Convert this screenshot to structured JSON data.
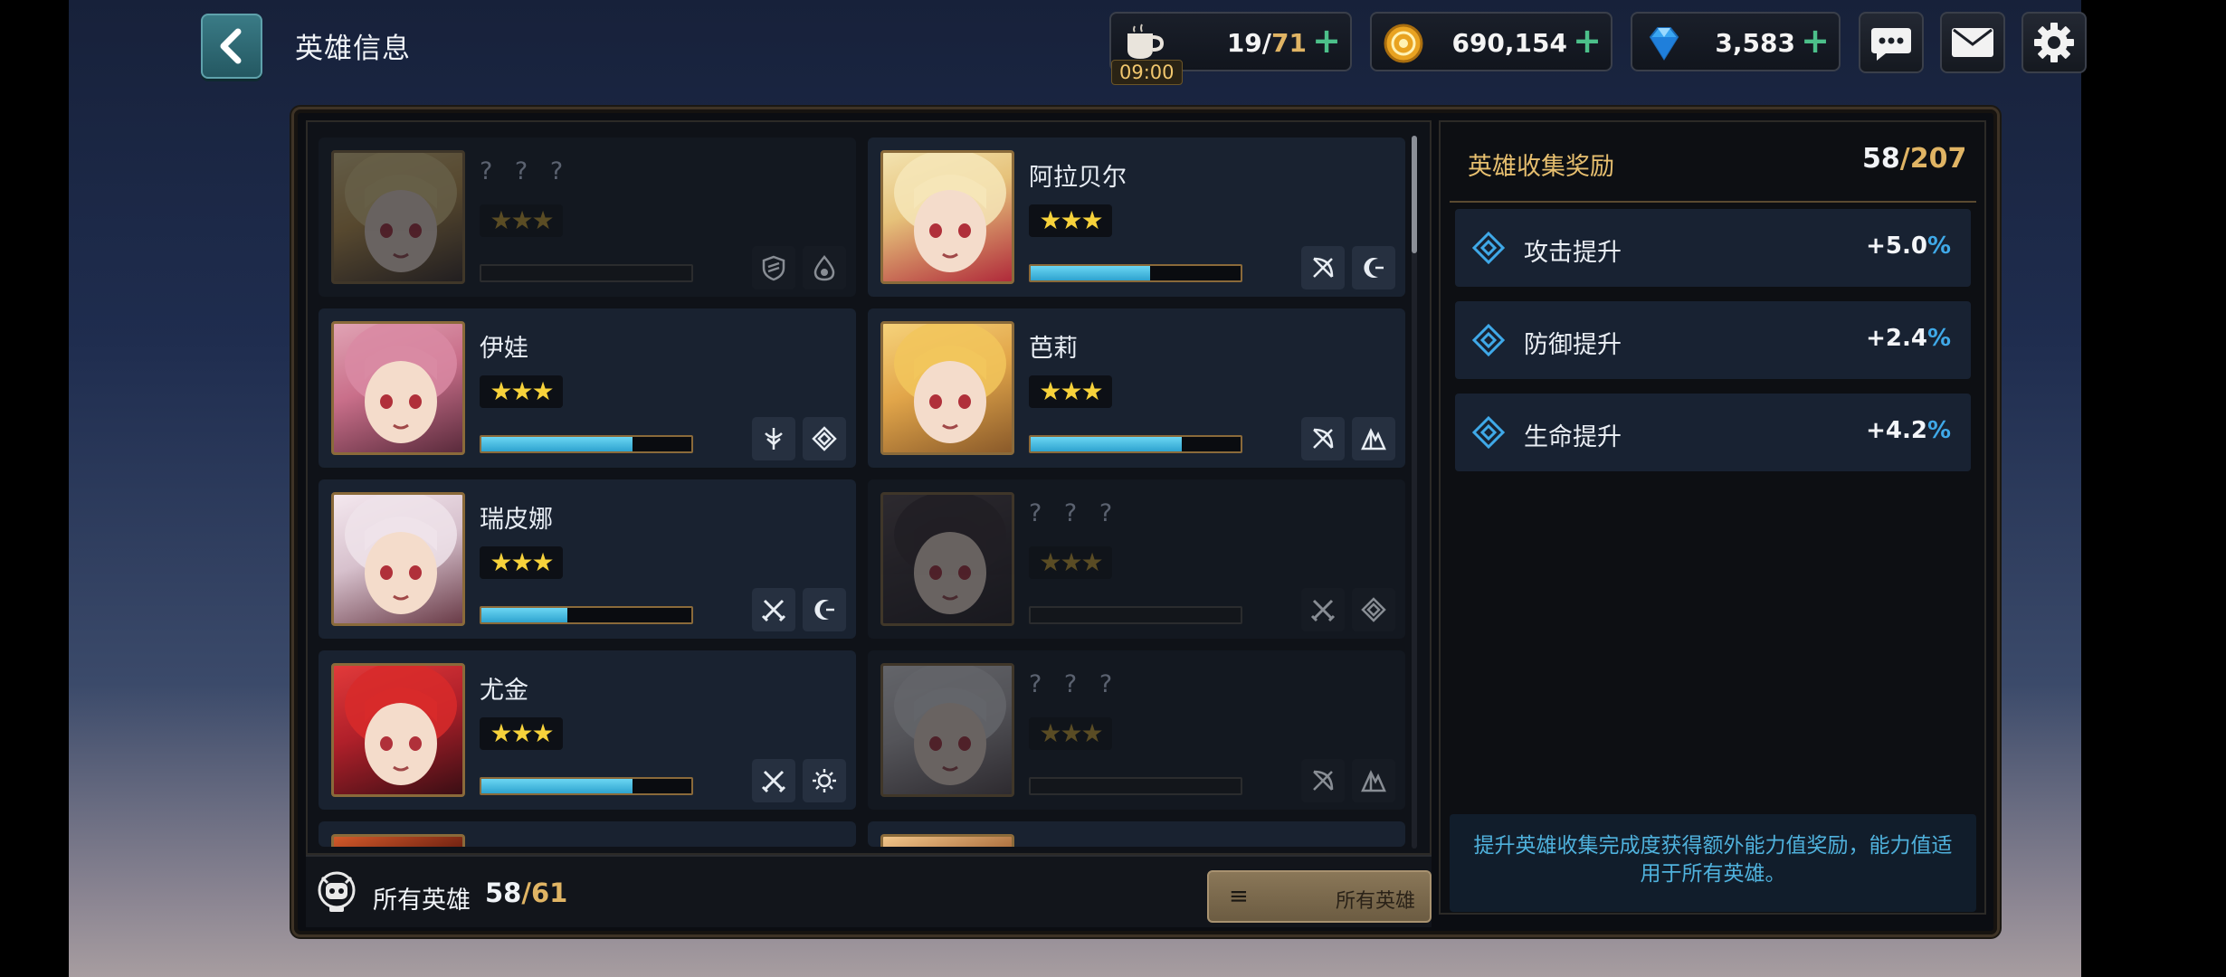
{
  "header": {
    "title": "英雄信息"
  },
  "resources": {
    "stamina": {
      "current": "19",
      "separator": "/",
      "max": "71",
      "timer": "09:00"
    },
    "gold": {
      "value": "690,154"
    },
    "gems": {
      "value": "3,583"
    },
    "plus_label": "+"
  },
  "heroes": [
    {
      "name": "? ? ?",
      "locked": true,
      "stars": "★★★",
      "progress": 0,
      "class_icon": "shield-icon",
      "element_icon": "water-drop-icon"
    },
    {
      "name": "阿拉贝尔",
      "locked": false,
      "stars": "★★★",
      "progress": 0.57,
      "class_icon": "bow-icon",
      "element_icon": "moon-icon"
    },
    {
      "name": "伊娃",
      "locked": false,
      "stars": "★★★",
      "progress": 0.72,
      "class_icon": "staff-icon",
      "element_icon": "diamond-icon"
    },
    {
      "name": "芭莉",
      "locked": false,
      "stars": "★★★",
      "progress": 0.72,
      "class_icon": "bow-icon",
      "element_icon": "mountain-icon"
    },
    {
      "name": "瑞皮娜",
      "locked": false,
      "stars": "★★★",
      "progress": 0.41,
      "class_icon": "crossed-swords-icon",
      "element_icon": "moon-icon"
    },
    {
      "name": "? ? ?",
      "locked": true,
      "stars": "★★★",
      "progress": 0,
      "class_icon": "crossed-swords-icon",
      "element_icon": "diamond-icon"
    },
    {
      "name": "尤金",
      "locked": false,
      "stars": "★★★",
      "progress": 0.72,
      "class_icon": "crossed-swords-icon",
      "element_icon": "sun-icon"
    },
    {
      "name": "? ? ?",
      "locked": true,
      "stars": "★★★",
      "progress": 0,
      "class_icon": "bow-icon",
      "element_icon": "mountain-icon"
    }
  ],
  "footer": {
    "label": "所有英雄",
    "count": "58",
    "separator": "/",
    "max": "61",
    "filter_label": "所有英雄"
  },
  "reward": {
    "title": "英雄收集奖励",
    "count": "58",
    "separator": "/",
    "max": "207",
    "bonuses": [
      {
        "label": "攻击提升",
        "value": "+5.0",
        "unit": "%"
      },
      {
        "label": "防御提升",
        "value": "+2.4",
        "unit": "%"
      },
      {
        "label": "生命提升",
        "value": "+4.2",
        "unit": "%"
      }
    ],
    "description": "提升英雄收集完成度获得额外能力值奖励，能力值适用于所有英雄。"
  },
  "colors": {
    "accent_gold": "#e0b464",
    "progress_blue": "#2ea3cf",
    "percent_blue": "#3fa9e8",
    "desc_text": "#4fb1dc",
    "plus_green": "#4cc08a",
    "star_yellow": "#f7d23b"
  }
}
